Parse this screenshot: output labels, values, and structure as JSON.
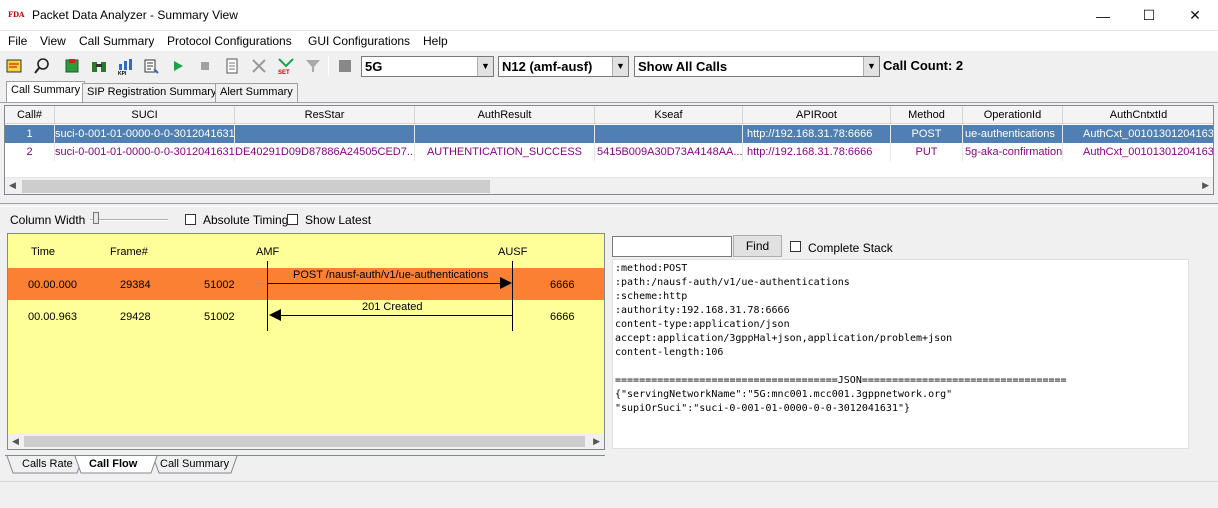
{
  "window": {
    "icon_text": "FDA",
    "title": "Packet Data Analyzer - Summary View",
    "minimize": "—",
    "maximize": "☐",
    "close": "✕"
  },
  "menu": [
    "File",
    "View",
    "Call Summary",
    "Protocol Configurations",
    "GUI Configurations",
    "Help"
  ],
  "toolbar": {
    "network_value": "5G",
    "interface_value": "N12 (amf-ausf)",
    "calls_filter_value": "Show All Calls",
    "call_count_label": "Call Count: 2"
  },
  "top_tabs": [
    "Call Summary",
    "SIP Registration Summary",
    "Alert Summary"
  ],
  "grid": {
    "columns": [
      "Call#",
      "SUCI",
      "ResStar",
      "AuthResult",
      "Kseaf",
      "APIRoot",
      "Method",
      "OperationId",
      "AuthCntxtId"
    ],
    "rows": [
      [
        "1",
        "suci-0-001-01-0000-0-0-3012041631",
        "",
        "",
        "",
        "http://192.168.31.78:6666",
        "POST",
        "ue-authentications",
        "AuthCxt_00101301204163"
      ],
      [
        "2",
        "suci-0-001-01-0000-0-0-3012041631",
        "DE40291D09D87886A24505CED7...",
        "AUTHENTICATION_SUCCESS",
        "5415B009A30D73A4148AA...",
        "http://192.168.31.78:6666",
        "PUT",
        "5g-aka-confirmation",
        "AuthCxt_00101301204163"
      ]
    ]
  },
  "options": {
    "column_width_label": "Column Width",
    "absolute_timing_label": "Absolute Timing",
    "show_latest_label": "Show Latest"
  },
  "call_flow": {
    "headers": [
      "Time",
      "Frame#",
      "AMF",
      "AUSF"
    ],
    "rows": [
      {
        "time": "00.00.000",
        "frame": "29384",
        "src_port": "51002",
        "message": "POST /nausf-auth/v1/ue-authentications",
        "dst_port": "6666"
      },
      {
        "time": "00.00.963",
        "frame": "29428",
        "src_port": "51002",
        "message": "201 Created",
        "dst_port": "6666"
      }
    ]
  },
  "bottom_tabs": [
    "Calls Rate",
    "Call Flow",
    "Call Summary"
  ],
  "find": {
    "button_label": "Find",
    "complete_stack_label": "Complete Stack",
    "input_value": ""
  },
  "detail_lines": [
    ":method:POST",
    ":path:/nausf-auth/v1/ue-authentications",
    ":scheme:http",
    ":authority:192.168.31.78:6666",
    "content-type:application/json",
    "accept:application/3gppHal+json,application/problem+json",
    "content-length:106",
    "",
    "=====================================JSON==================================",
    "{\"servingNetworkName\":\"5G:mnc001.mcc001.3gppnetwork.org\"",
    "\"supiOrSuci\":\"suci-0-001-01-0000-0-0-3012041631\"}"
  ]
}
